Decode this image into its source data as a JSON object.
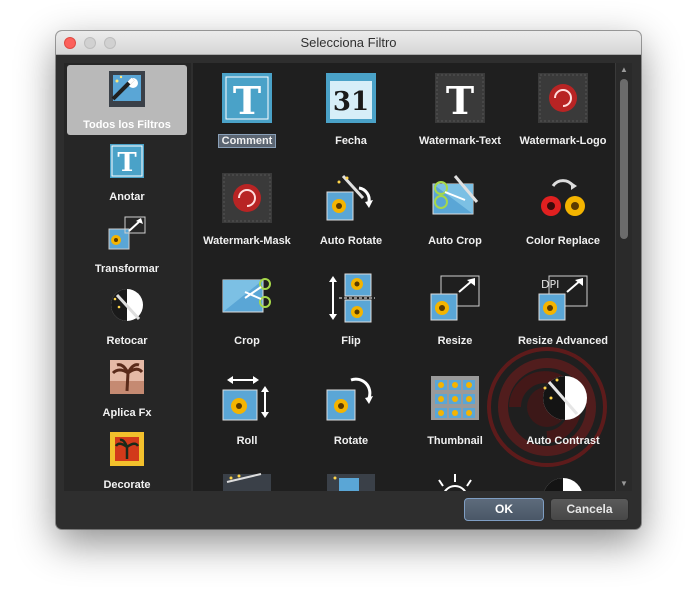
{
  "window": {
    "title": "Selecciona Filtro"
  },
  "sidebar": {
    "items": [
      {
        "label": "Todos los Filtros",
        "icon": "magic-wand-icon",
        "selected": true
      },
      {
        "label": "Anotar",
        "icon": "text-t-icon"
      },
      {
        "label": "Transformar",
        "icon": "resize-arrows-icon"
      },
      {
        "label": "Retocar",
        "icon": "contrast-wand-icon"
      },
      {
        "label": "Aplica Fx",
        "icon": "palm-fx-icon"
      },
      {
        "label": "Decorate",
        "icon": "decorate-frame-icon"
      }
    ]
  },
  "filters": [
    {
      "label": "Comment",
      "icon": "text-t-icon",
      "highlighted": true
    },
    {
      "label": "Fecha",
      "icon": "calendar-icon",
      "calendar_text": "31"
    },
    {
      "label": "Watermark-Text",
      "icon": "watermark-text-icon"
    },
    {
      "label": "Watermark-Logo",
      "icon": "watermark-logo-icon"
    },
    {
      "label": "Watermark-Mask",
      "icon": "watermark-mask-icon"
    },
    {
      "label": "Auto Rotate",
      "icon": "auto-rotate-icon"
    },
    {
      "label": "Auto Crop",
      "icon": "auto-crop-icon"
    },
    {
      "label": "Color Replace",
      "icon": "color-replace-icon"
    },
    {
      "label": "Crop",
      "icon": "crop-scissors-icon"
    },
    {
      "label": "Flip",
      "icon": "flip-icon"
    },
    {
      "label": "Resize",
      "icon": "resize-icon"
    },
    {
      "label": "Resize Advanced",
      "icon": "resize-advanced-icon",
      "badge_text": "DPI"
    },
    {
      "label": "Roll",
      "icon": "roll-icon"
    },
    {
      "label": "Rotate",
      "icon": "rotate-icon"
    },
    {
      "label": "Thumbnail",
      "icon": "thumbnail-icon"
    },
    {
      "label": "Auto Contrast",
      "icon": "auto-contrast-icon"
    }
  ],
  "buttons": {
    "ok": "OK",
    "cancel": "Cancela"
  },
  "colors": {
    "window_bg": "#2e2e2e",
    "selected_bg": "#b9b9b9",
    "ok_border": "#7f9ec3",
    "watermark_red": "#8a1c1c"
  }
}
